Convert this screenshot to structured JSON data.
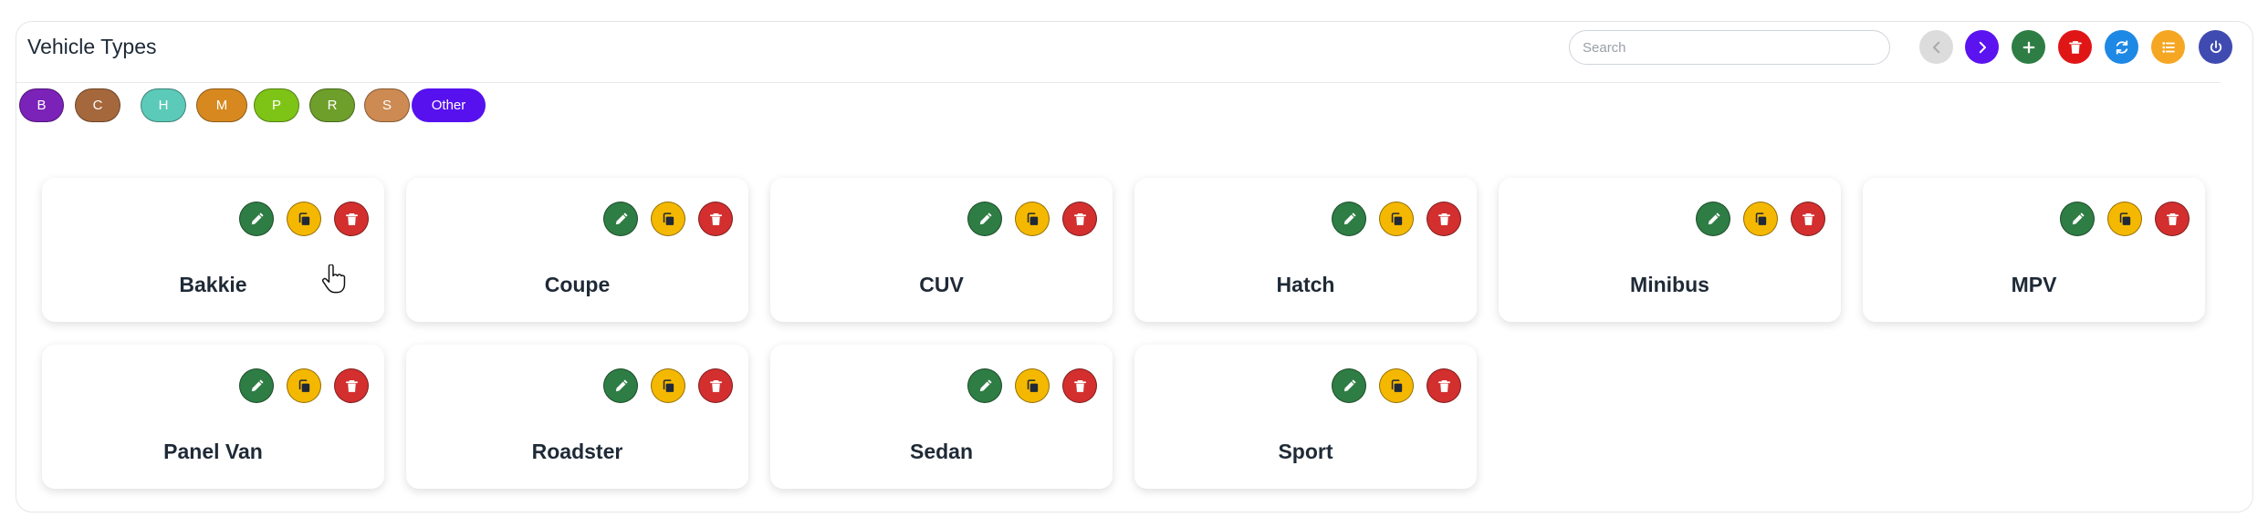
{
  "header": {
    "title": "Vehicle Types",
    "search_placeholder": "Search"
  },
  "toolbar": [
    {
      "name": "prev-button",
      "icon": "chevron-left-icon",
      "color": "#dcdcdc",
      "disabled": true
    },
    {
      "name": "next-button",
      "icon": "chevron-right-icon",
      "color": "#5b13f0"
    },
    {
      "name": "add-button",
      "icon": "plus-icon",
      "color": "#2e7d44"
    },
    {
      "name": "delete-button",
      "icon": "trash-icon",
      "color": "#e01616"
    },
    {
      "name": "refresh-button",
      "icon": "refresh-icon",
      "color": "#1e88e5"
    },
    {
      "name": "list-view-button",
      "icon": "list-icon",
      "color": "#f5a623"
    },
    {
      "name": "power-button",
      "icon": "power-icon",
      "color": "#3f4bb0"
    }
  ],
  "filters": [
    {
      "label": "B",
      "color": "#7b22b8"
    },
    {
      "label": "C",
      "color": "#a5683c"
    },
    {
      "label": "H",
      "color": "#5ccab8"
    },
    {
      "label": "M",
      "color": "#d7891f"
    },
    {
      "label": "P",
      "color": "#7ec417"
    },
    {
      "label": "R",
      "color": "#6e9f2a"
    },
    {
      "label": "S",
      "color": "#cd8a52"
    },
    {
      "label": "Other",
      "color": "#5611ee"
    }
  ],
  "vehicle_types": [
    "Bakkie",
    "Coupe",
    "CUV",
    "Hatch",
    "Minibus",
    "MPV",
    "Panel Van",
    "Roadster",
    "Sedan",
    "Sport"
  ]
}
